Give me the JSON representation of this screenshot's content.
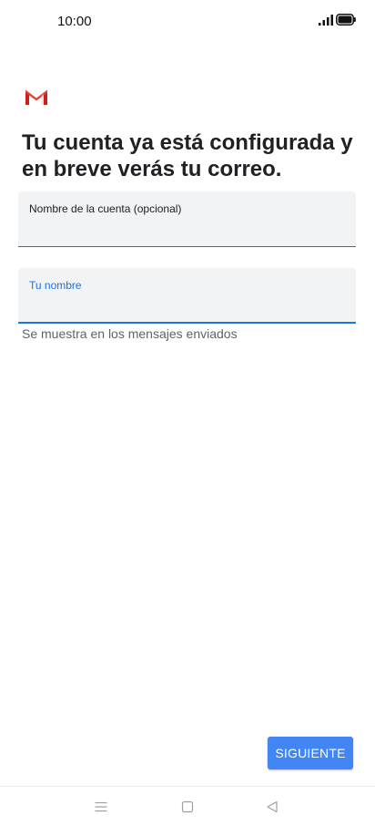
{
  "status_bar": {
    "time": "10:00",
    "signal_icon": "signal-icon",
    "battery_icon": "battery-icon"
  },
  "header": {
    "logo_icon": "gmail-icon",
    "title": "Tu cuenta ya está configurada y en breve verás tu correo."
  },
  "form": {
    "account_name": {
      "label": "Nombre de la cuenta (opcional)",
      "value": ""
    },
    "your_name": {
      "label": "Tu nombre",
      "value": "",
      "helper": "Se muestra en los mensajes enviados"
    }
  },
  "actions": {
    "next_label": "SIGUIENTE"
  },
  "colors": {
    "accent": "#1a73e8",
    "button": "#4285f4",
    "field_bg": "#f1f3f4"
  },
  "nav_bar": {
    "icons": [
      "menu-icon",
      "home-icon",
      "back-icon"
    ]
  }
}
